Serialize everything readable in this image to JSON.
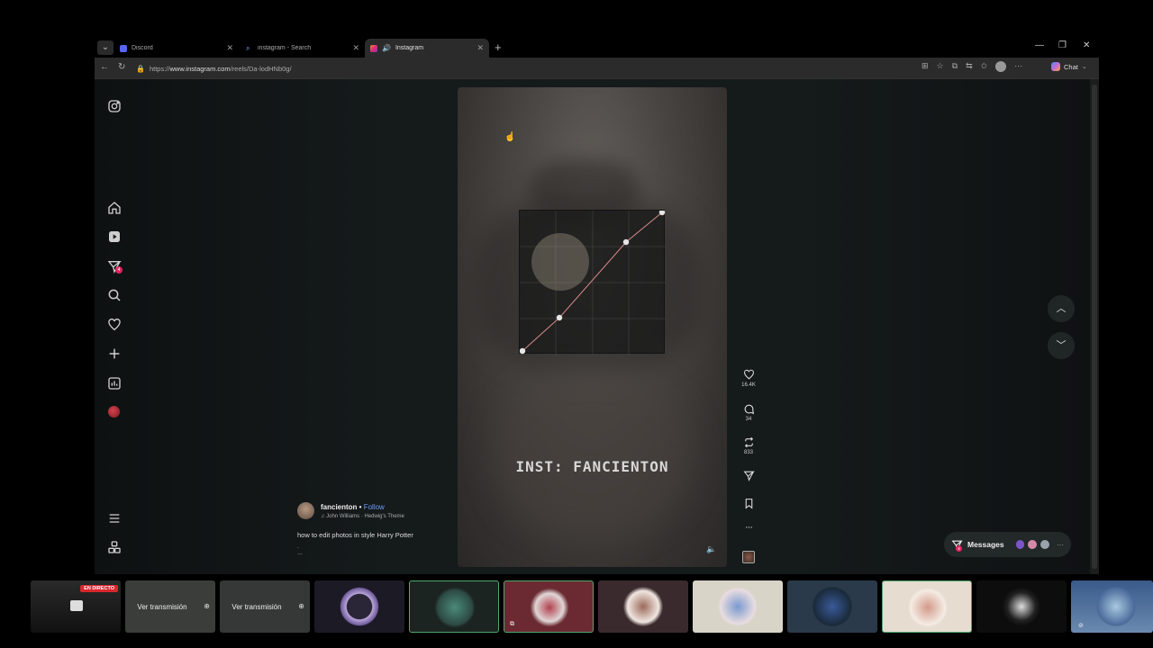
{
  "browser": {
    "tabs": [
      {
        "title": "Discord",
        "active": false,
        "favicon_color": "#5865f2"
      },
      {
        "title": "instagram - Search",
        "active": false,
        "favicon_color": "#8ab4f8"
      },
      {
        "title": "Instagram",
        "active": true,
        "favicon_color": "#e1306c"
      }
    ],
    "url_prefix": "https://",
    "url_host": "www.instagram.com",
    "url_path": "/reels/Da-lodHNb0g/",
    "chat_label": "Chat"
  },
  "instagram": {
    "sidebar": [
      {
        "name": "instagram-logo-icon"
      },
      {
        "name": "home-icon"
      },
      {
        "name": "reels-icon"
      },
      {
        "name": "messages-icon",
        "badge": "4"
      },
      {
        "name": "search-icon"
      },
      {
        "name": "notifications-heart-icon"
      },
      {
        "name": "create-plus-icon"
      },
      {
        "name": "dashboard-icon"
      },
      {
        "name": "profile-icon"
      },
      {
        "name": "menu-icon"
      },
      {
        "name": "more-apps-icon"
      }
    ],
    "reel": {
      "overlay_text": "INST: FANCIENTON",
      "username": "fancienton",
      "separator": " • ",
      "follow_label": "Follow",
      "audio": "♫ John Williams · Hedwig's Theme",
      "caption": "how to edit photos in style Harry Potter",
      "caption_more": ".",
      "ellipsis": "..."
    },
    "actions": {
      "likes": "16.4K",
      "comments": "34",
      "reposts": "833"
    },
    "messages": {
      "label": "Messages",
      "badge": "4"
    }
  },
  "stream_strip": {
    "live_badge": "EN DIRECTO",
    "watch_label": "Ver transmisión"
  }
}
